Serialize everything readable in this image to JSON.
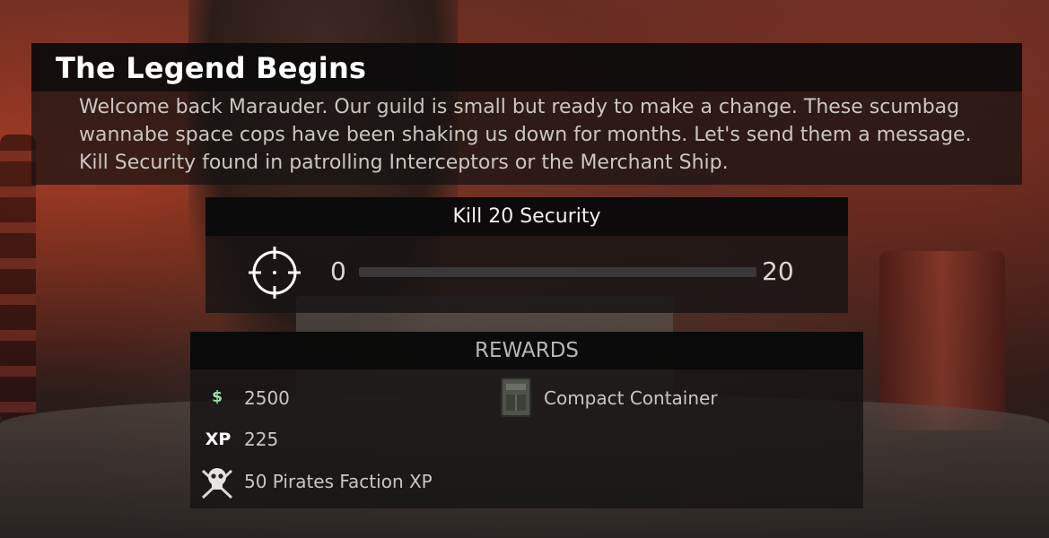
{
  "quest": {
    "title": "The Legend Begins",
    "description": "Welcome back Marauder. Our guild is small but ready to make a change. These scumbag wannabe space cops have been shaking us down for months. Let's send them a message. Kill Security found in patrolling Interceptors or the Merchant Ship."
  },
  "objective": {
    "title": "Kill 20 Security",
    "icon": "crosshair-icon",
    "progress_current": "0",
    "progress_max": "20",
    "progress_fraction": 0
  },
  "rewards": {
    "title": "REWARDS",
    "money": {
      "icon": "$",
      "value": "2500"
    },
    "xp": {
      "icon": "XP",
      "value": "225"
    },
    "faction": {
      "icon": "skull-crossed-swords-icon",
      "label": "50 Pirates Faction XP"
    },
    "item": {
      "icon": "container-icon",
      "label": "Compact Container"
    }
  },
  "colors": {
    "accent_money": "#9de0a8",
    "panel_bg": "#161414",
    "text": "#c9c6c2"
  }
}
